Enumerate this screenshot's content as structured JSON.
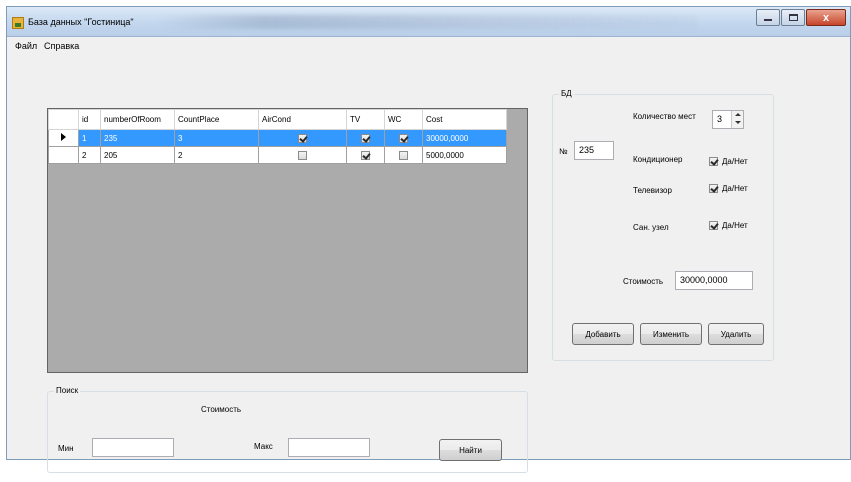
{
  "window": {
    "title": "База данных \"Гостиница\"",
    "close_label": "x"
  },
  "menu": {
    "items": [
      "Файл",
      "Справка"
    ]
  },
  "grid": {
    "columns": [
      "id",
      "numberOfRoom",
      "CountPlace",
      "AirCond",
      "TV",
      "WC",
      "Cost"
    ],
    "rows": [
      {
        "id": "1",
        "numberOfRoom": "235",
        "CountPlace": "3",
        "AirCond": true,
        "TV": true,
        "WC": true,
        "Cost": "30000,0000",
        "selected": true
      },
      {
        "id": "2",
        "numberOfRoom": "205",
        "CountPlace": "2",
        "AirCond": false,
        "TV": true,
        "WC": false,
        "Cost": "5000,0000",
        "selected": false
      }
    ]
  },
  "search": {
    "group_title": "Поиск",
    "cost_label": "Стоимость",
    "min_label": "Мин",
    "min_value": "",
    "max_label": "Макс",
    "max_value": "",
    "find_button": "Найти"
  },
  "db_panel": {
    "group_title": "БД",
    "number_label": "№",
    "number_value": "235",
    "places_label": "Количество мест",
    "places_value": "3",
    "aircond_label": "Кондиционер",
    "aircond_check_label": "Да/Нет",
    "aircond_checked": true,
    "tv_label": "Телевизор",
    "tv_check_label": "Да/Нет",
    "tv_checked": true,
    "wc_label": "Сан. узел",
    "wc_check_label": "Да/Нет",
    "wc_checked": true,
    "cost_label": "Стоимость",
    "cost_value": "30000,0000",
    "add_button": "Добавить",
    "edit_button": "Изменить",
    "delete_button": "Удалить"
  }
}
